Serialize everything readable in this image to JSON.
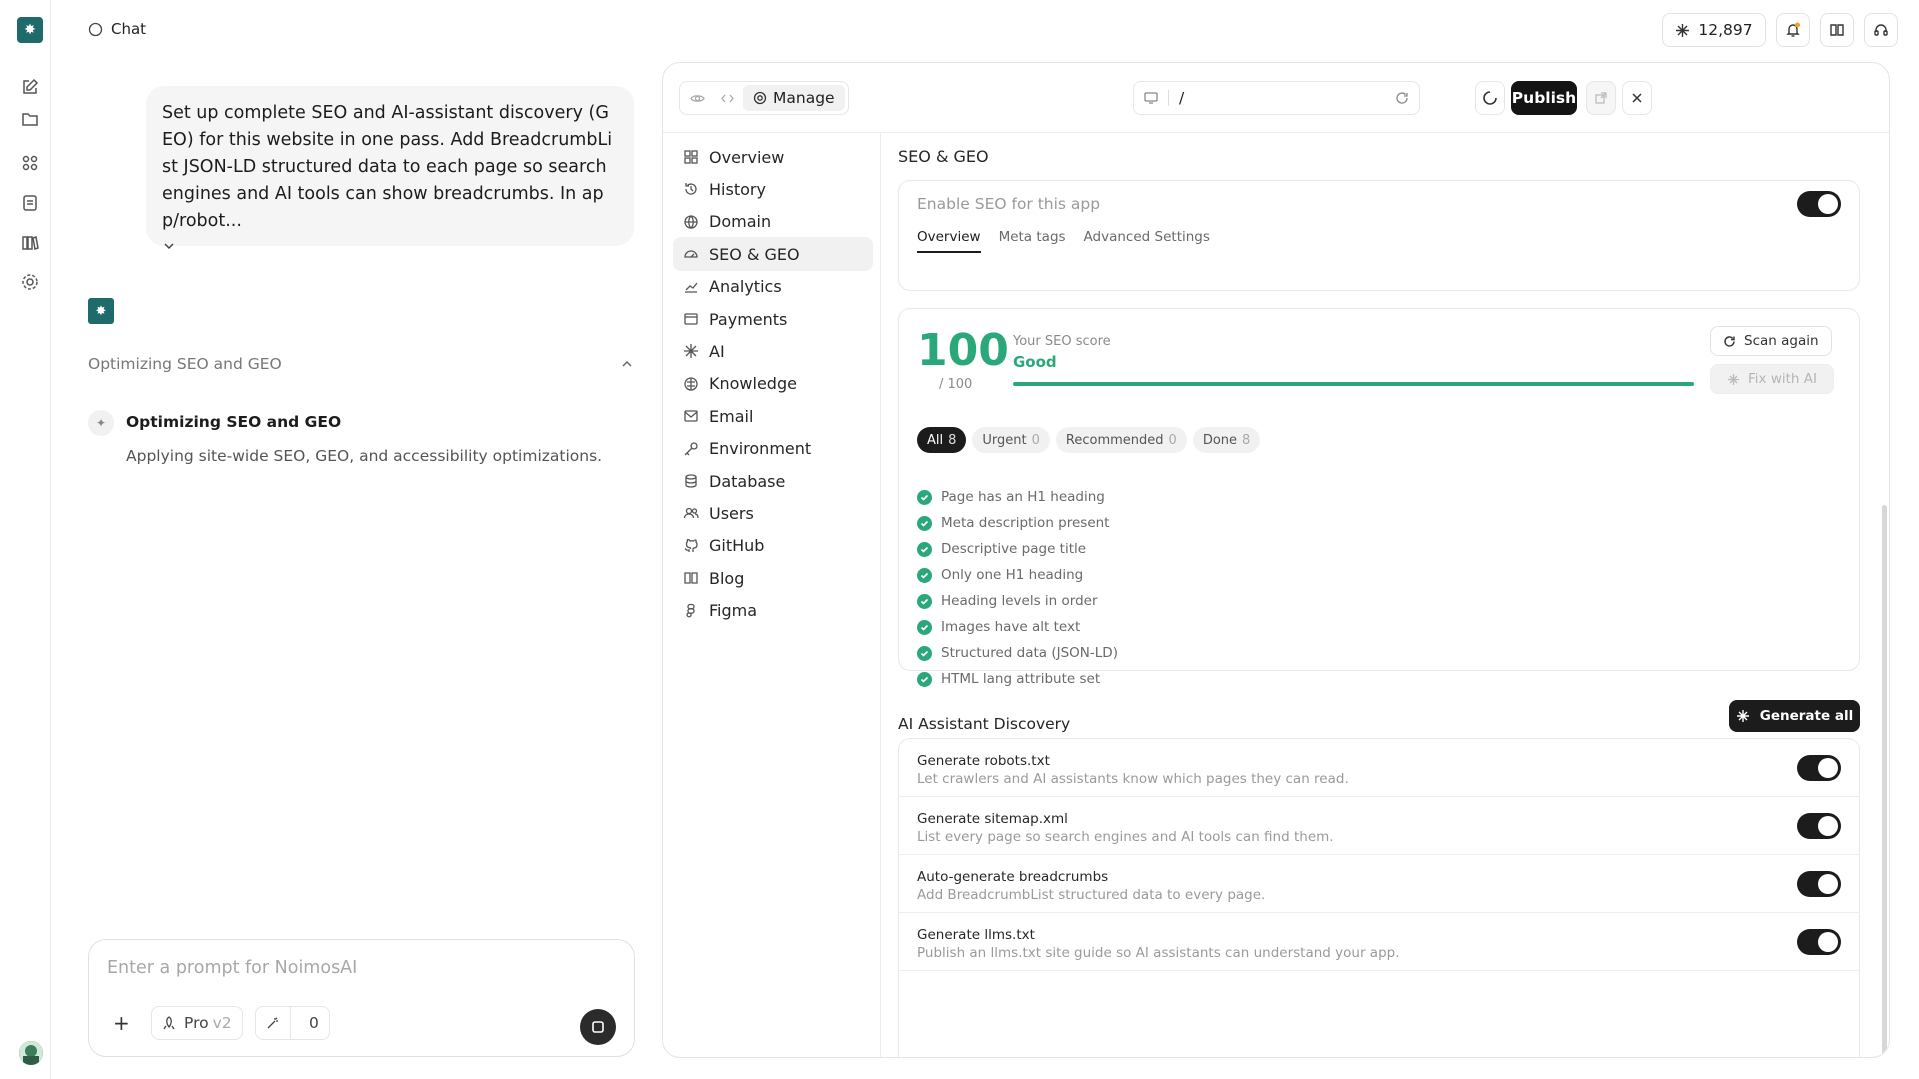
{
  "header": {
    "chat_label": "Chat",
    "credits": "12,897"
  },
  "message": {
    "text": "Set up complete SEO and AI-assistant discovery (GEO) for this website in one pass. Add BreadcrumbList JSON-LD structured data to each page so search engines and AI tools can show breadcrumbs. In app/robot..."
  },
  "progress": {
    "header": "Optimizing SEO and GEO",
    "step_title": "Optimizing SEO and GEO",
    "step_desc": "Applying site-wide SEO, GEO, and accessibility optimizations."
  },
  "composer": {
    "placeholder": "Enter a prompt for NoimosAI",
    "model": "Pro",
    "model_version": "v2",
    "count": "0"
  },
  "toolbar": {
    "manage_label": "Manage",
    "url_path": "/",
    "publish_label": "Publish"
  },
  "nav": {
    "items": [
      {
        "label": "Overview",
        "icon": "grid-icon"
      },
      {
        "label": "History",
        "icon": "history-icon"
      },
      {
        "label": "Domain",
        "icon": "globe-icon"
      },
      {
        "label": "SEO & GEO",
        "icon": "gauge-icon",
        "active": true
      },
      {
        "label": "Analytics",
        "icon": "chart-icon"
      },
      {
        "label": "Payments",
        "icon": "card-icon"
      },
      {
        "label": "AI",
        "icon": "sparkle-icon"
      },
      {
        "label": "Knowledge",
        "icon": "brain-icon"
      },
      {
        "label": "Email",
        "icon": "mail-icon"
      },
      {
        "label": "Environment",
        "icon": "key-icon"
      },
      {
        "label": "Database",
        "icon": "database-icon"
      },
      {
        "label": "Users",
        "icon": "users-icon"
      },
      {
        "label": "GitHub",
        "icon": "github-icon"
      },
      {
        "label": "Blog",
        "icon": "book-icon"
      },
      {
        "label": "Figma",
        "icon": "figma-icon"
      }
    ]
  },
  "seo": {
    "title": "SEO & GEO",
    "enable_label": "Enable SEO for this app",
    "tabs": [
      "Overview",
      "Meta tags",
      "Advanced Settings"
    ],
    "score": "100",
    "score_max": "/ 100",
    "score_label": "Your SEO score",
    "score_status": "Good",
    "score_fraction": 1.0,
    "scan_label": "Scan again",
    "fix_label": "Fix with AI",
    "filters": [
      {
        "label": "All",
        "count": "8"
      },
      {
        "label": "Urgent",
        "count": "0"
      },
      {
        "label": "Recommended",
        "count": "0"
      },
      {
        "label": "Done",
        "count": "8"
      }
    ],
    "checks": [
      "Page has an H1 heading",
      "Meta description present",
      "Descriptive page title",
      "Only one H1 heading",
      "Heading levels in order",
      "Images have alt text",
      "Structured data (JSON-LD)",
      "HTML lang attribute set"
    ]
  },
  "ai_discovery": {
    "title": "AI Assistant Discovery",
    "generate_all": "Generate all",
    "items": [
      {
        "title": "Generate robots.txt",
        "desc": "Let crawlers and AI assistants know which pages they can read."
      },
      {
        "title": "Generate sitemap.xml",
        "desc": "List every page so search engines and AI tools can find them."
      },
      {
        "title": "Auto-generate breadcrumbs",
        "desc": "Add BreadcrumbList structured data to every page."
      },
      {
        "title": "Generate llms.txt",
        "desc": "Publish an llms.txt site guide so AI assistants can understand your app."
      }
    ]
  },
  "colors": {
    "accent": "#2aa87a",
    "brand": "#1f6b6b",
    "dark": "#1c1c1c"
  }
}
